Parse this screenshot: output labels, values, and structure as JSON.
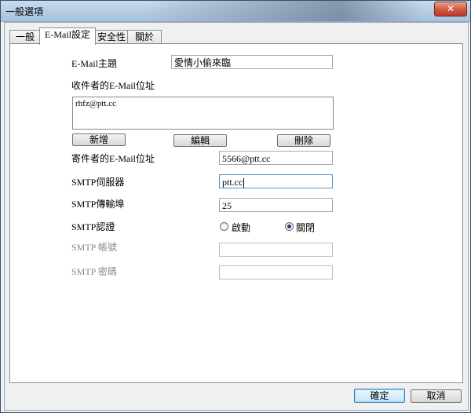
{
  "window": {
    "title": "一般選項",
    "close_glyph": "✕"
  },
  "tabs": [
    {
      "label": "一般"
    },
    {
      "label": "E-Mail設定"
    },
    {
      "label": "安全性"
    },
    {
      "label": "關於"
    }
  ],
  "email": {
    "subject_label": "E-Mail主題",
    "subject_value": "愛情小偷來臨",
    "recipients_label": "收件者的E-Mail位址",
    "recipients": [
      "rhfz@ptt.cc"
    ],
    "add_button": "新增",
    "edit_button": "編輯",
    "delete_button": "刪除",
    "sender_label": "寄件者的E-Mail位址",
    "sender_value": "5566@ptt.cc",
    "smtp_server_label": "SMTP伺服器",
    "smtp_server_value": "ptt.cc",
    "smtp_port_label": "SMTP傳輸埠",
    "smtp_port_value": "25",
    "smtp_auth_label": "SMTP認證",
    "auth_on_label": "啟動",
    "auth_off_label": "關閉",
    "auth_selected": "off",
    "smtp_account_label": "SMTP 帳號",
    "smtp_account_value": "",
    "smtp_password_label": "SMTP 密碼",
    "smtp_password_value": ""
  },
  "footer": {
    "ok_button": "確定",
    "cancel_button": "取消"
  }
}
